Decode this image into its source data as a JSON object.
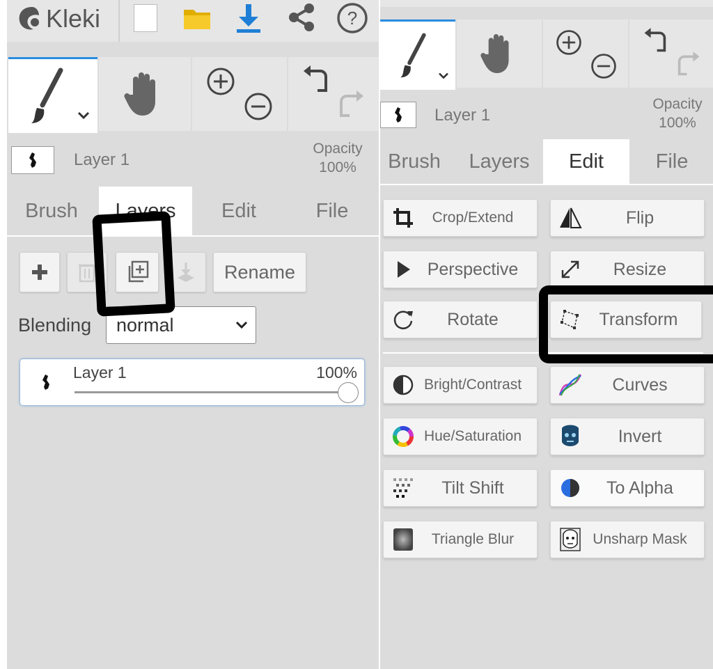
{
  "app": {
    "name": "Kleki"
  },
  "left": {
    "layer_label": "Layer 1",
    "opacity_label": "Opacity",
    "opacity_value": "100%",
    "tabs": [
      {
        "label": "Brush",
        "active": false
      },
      {
        "label": "Layers",
        "active": true
      },
      {
        "label": "Edit",
        "active": false
      },
      {
        "label": "File",
        "active": false
      }
    ],
    "layers_panel": {
      "rename_label": "Rename",
      "blending_label": "Blending",
      "blending_value": "normal",
      "layer_item": {
        "name": "Layer 1",
        "opacity": "100%",
        "opacity_fraction": 1.0
      }
    }
  },
  "right": {
    "layer_label": "Layer 1",
    "opacity_label": "Opacity",
    "opacity_value": "100%",
    "tabs": [
      {
        "label": "Brush",
        "active": false
      },
      {
        "label": "Layers",
        "active": false
      },
      {
        "label": "Edit",
        "active": true
      },
      {
        "label": "File",
        "active": false
      }
    ],
    "edit_buttons": {
      "crop": "Crop/Extend",
      "flip": "Flip",
      "perspective": "Perspective",
      "resize": "Resize",
      "rotate": "Rotate",
      "transform": "Transform",
      "bright_contrast": "Bright/Contrast",
      "curves": "Curves",
      "hue_saturation": "Hue/Saturation",
      "invert": "Invert",
      "tilt_shift": "Tilt Shift",
      "to_alpha": "To Alpha",
      "triangle_blur": "Triangle Blur",
      "unsharp_mask": "Unsharp Mask"
    }
  },
  "colors": {
    "accent": "#2a8be0",
    "download": "#1f7fd6",
    "folder": "#f2c200"
  }
}
